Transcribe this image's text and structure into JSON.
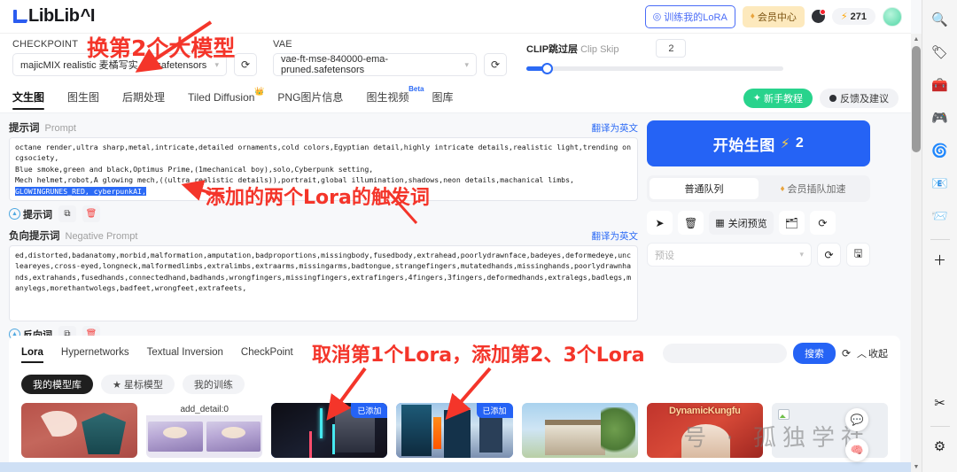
{
  "app": {
    "logo_text": "LibLib",
    "logo_suffix": "^I"
  },
  "header": {
    "train_lora_label": "训练我的LoRA",
    "train_lora_icon": "target-icon",
    "vip_label": "会员中心",
    "vip_icon": "diamond-icon",
    "message_icon": "message-bubble-icon",
    "credits_value": "271",
    "credits_icon": "bolt-icon",
    "avatar_icon": "user-avatar"
  },
  "modelbar": {
    "checkpoint_label": "CHECKPOINT",
    "checkpoint_value": "majicMIX realistic 麦橘写实_v7.safetensors",
    "vae_label": "VAE",
    "vae_value": "vae-ft-mse-840000-ema-pruned.safetensors",
    "clip_skip_label_cn": "CLIP跳过层",
    "clip_skip_label_en": "Clip Skip",
    "clip_skip_value": "2",
    "refresh_icon": "refresh-icon"
  },
  "tabs": [
    {
      "label": "文生图",
      "active": true
    },
    {
      "label": "图生图",
      "active": false
    },
    {
      "label": "后期处理",
      "active": false
    },
    {
      "label": "Tiled Diffusion",
      "active": false,
      "crown": "👑"
    },
    {
      "label": "PNG图片信息",
      "active": false
    },
    {
      "label": "图生视频",
      "active": false,
      "beta": "Beta"
    },
    {
      "label": "图库",
      "active": false
    }
  ],
  "tabs_right": {
    "tutorial_label": "新手教程",
    "tutorial_icon": "sparkle-icon",
    "feedback_label": "反馈及建议",
    "feedback_icon": "chat-dot-icon"
  },
  "prompt": {
    "label_cn": "提示词",
    "label_en": "Prompt",
    "translate_label": "翻译为英文",
    "lines": [
      "octane render,ultra sharp,metal,intricate,detailed ornaments,cold colors,Egyptian detail,highly intricate details,realistic light,trending on cgsociety,",
      "Blue smoke,green and black,Optimus Prime,(1mechanical boy),solo,Cyberpunk setting,",
      "Mech helmet,robot,A glowing mech,((ultra realistic details)),portrait,global illumination,shadows,neon details,machanical limbs,"
    ],
    "trigger_line": "GLOWINGRUNES_RED, cyberpunkAI,",
    "action_label": "提示词",
    "copy_icon": "copy-icon",
    "delete_icon": "trash-icon"
  },
  "negative_prompt": {
    "label_cn": "负向提示词",
    "label_en": "Negative Prompt",
    "translate_label": "翻译为英文",
    "text": "ed,distorted,badanatomy,morbid,malformation,amputation,badproportions,missingbody,fusedbody,extrahead,poorlydrawnface,badeyes,deformedeye,uncleareyes,cross-eyed,longneck,malformedlimbs,extralimbs,extraarms,missingarms,badtongue,strangefingers,mutatedhands,missinghands,poorlydrawnhands,extrahands,fusedhands,connectedhand,badhands,wrongfingers,missingfingers,extrafingers,4fingers,3fingers,deformedhands,extralegs,badlegs,manylegs,morethantwolegs,badfeet,wrongfeet,extrafeets,",
    "action_label": "反向词",
    "copy_icon": "copy-icon",
    "delete_icon": "trash-icon"
  },
  "generate": {
    "button_label": "开始生图",
    "bolt_icon": "bolt-icon",
    "cost": "2",
    "queue_normal": "普通队列",
    "queue_vip": "会员插队加速",
    "queue_vip_icon": "diamond-icon",
    "tools": [
      {
        "name": "send-icon",
        "glyph": "➤"
      },
      {
        "name": "trash-icon",
        "glyph": "🗑"
      },
      {
        "name": "close-preview-button",
        "glyph": "▦",
        "label": "关闭预览"
      },
      {
        "name": "folder-icon",
        "glyph": "🗂"
      },
      {
        "name": "refresh-icon",
        "glyph": "⟳"
      }
    ],
    "preset_placeholder": "预设",
    "preset_refresh_icon": "refresh-icon",
    "preset_save_icon": "save-icon"
  },
  "lora": {
    "tabs": [
      {
        "label": "Lora",
        "active": true
      },
      {
        "label": "Hypernetworks",
        "active": false
      },
      {
        "label": "Textual Inversion",
        "active": false
      },
      {
        "label": "CheckPoint",
        "active": false
      }
    ],
    "search_placeholder": "",
    "search_button": "搜索",
    "refresh_icon": "refresh-icon",
    "collapse_label": "收起",
    "collapse_icon": "chevron-up-icon",
    "filters": [
      {
        "label": "我的模型库",
        "active": true
      },
      {
        "label": "★ 星标模型",
        "active": false
      },
      {
        "label": "我的训练",
        "active": false
      }
    ],
    "cards": [
      {
        "name": "lora-card-temple",
        "art": "art-temple",
        "title": "",
        "added": false,
        "selected": false
      },
      {
        "name": "lora-card-add-detail",
        "art": "art-anime",
        "title": "add_detail:0",
        "added": false,
        "selected": false
      },
      {
        "name": "lora-card-cyberpunk-mech",
        "art": "art-cyber-dark",
        "title": "",
        "added": true,
        "added_label": "已添加",
        "selected": true
      },
      {
        "name": "lora-card-cyberpunk-city",
        "art": "art-cyber-street",
        "title": "",
        "added": true,
        "added_label": "已添加",
        "selected": true
      },
      {
        "name": "lora-card-building",
        "art": "art-building",
        "title": "",
        "added": false,
        "selected": false
      },
      {
        "name": "lora-card-dynamic-kungfu",
        "art": "art-kungfu",
        "title": "DynamicKungfu",
        "added": false,
        "selected": false
      },
      {
        "name": "lora-card-broken",
        "art": "art-broken",
        "title": "",
        "added": false,
        "selected": false
      }
    ]
  },
  "annotations": {
    "checkpoint_note": "换第2个大模型",
    "trigger_note": "添加的两个Lora的触发词",
    "lora_note": "取消第1个Lora，添加第2、3个Lora"
  },
  "watermark": "号 · 孤独学社",
  "browser_rail": [
    {
      "name": "search-icon",
      "glyph": "🔍"
    },
    {
      "name": "tag-icon",
      "glyph": "🏷"
    },
    {
      "name": "briefcase-icon",
      "glyph": "🧰"
    },
    {
      "name": "game-icon",
      "glyph": "🎮"
    },
    {
      "name": "copilot-icon",
      "glyph": "🌀"
    },
    {
      "name": "outlook-icon",
      "glyph": "📧"
    },
    {
      "name": "paper-plane-icon",
      "glyph": "📨"
    },
    {
      "name": "add-sidebar-icon",
      "glyph": "＋"
    }
  ],
  "browser_rail_bottom": [
    {
      "name": "screenshot-icon",
      "glyph": "✂"
    },
    {
      "name": "settings-gear-icon",
      "glyph": "⚙"
    }
  ],
  "float_buttons": [
    {
      "name": "feedback-float-icon",
      "glyph": "💬"
    },
    {
      "name": "ai-brain-float-icon",
      "glyph": "🧠"
    }
  ]
}
